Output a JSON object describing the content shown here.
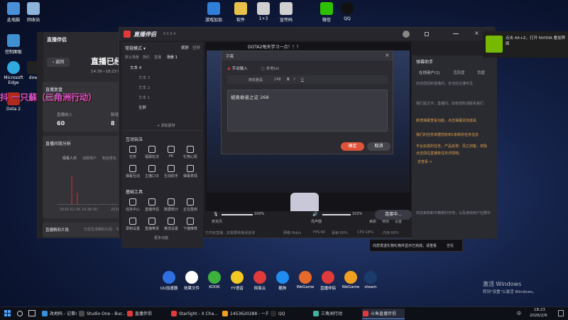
{
  "desktop": {
    "icons": [
      {
        "label": "此电脑",
        "color": "#4a90d9"
      },
      {
        "label": "回收站",
        "color": "#8fb4d9"
      },
      {
        "label": "控制面板",
        "color": "#3f8fd1"
      },
      {
        "label": "Microsoft Edge",
        "color": "#2fa9e0"
      },
      {
        "label": "Dota 2",
        "color": "#b12a1d"
      }
    ],
    "top_icons": [
      {
        "label": "游戏加加",
        "color": "#2f7fd8"
      },
      {
        "label": "软件",
        "color": "#e8c24a"
      },
      {
        "label": "1+3",
        "color": "#d0d0d0"
      },
      {
        "label": "宣传码",
        "color": "#d0d0d0"
      },
      {
        "label": "微信",
        "color": "#2dc100"
      },
      {
        "label": "QQ",
        "color": "#111111"
      }
    ],
    "download_label": "dow"
  },
  "dashboard": {
    "logo": "直播伴侣",
    "back_label": "返回",
    "heading": "直播已经",
    "time_range": "14:36~18:23 时",
    "review_title": "直播复盘",
    "data_summary": "数据汇总",
    "metric1_label": "直播收入",
    "metric1_value": "60",
    "metric2_label": "新增粉丝",
    "metric2_value": "8",
    "analysis_title": "直播间效分析",
    "chart_tabs": [
      "观看人次",
      "消费用户",
      "粉丝变化"
    ],
    "chart_date_start": "2026-02-06 14:36:00",
    "chart_date_end": "2026-02-",
    "highlights_title": "直播精彩片段",
    "highlights_note": "已自生成精彩片段：今天"
  },
  "overlay_banner": "抖 一只蘇（三角洲行动）",
  "main_window": {
    "brand": "直播伴侣",
    "version": "6.5.5.4",
    "stream_title": "DOTA2每天学习一点！！！",
    "mode_label": "常规模式",
    "landscape": "横屏",
    "portrait": "竖屏",
    "tabs": [
      "默认场景",
      "简约",
      "直播",
      "场景 1"
    ],
    "sources": [
      "文本 4",
      "文本 3",
      "文本 2",
      "文本 1",
      "全屏"
    ],
    "add_material": "添加素材",
    "interactive_title": "互动玩法",
    "interactive_tools": [
      "任务",
      "福袋玩法",
      "PK",
      "礼物心愿",
      "弹幕互动",
      "主播口令",
      "互动助手",
      "弹幕表情"
    ],
    "basic_title": "基础工具",
    "basic_tools": [
      "任务中心",
      "直播伴侣",
      "数据统计",
      "正在签到",
      "录制设置",
      "直播带货",
      "推流设置",
      "下播推荐"
    ],
    "more_tools": "更多功能",
    "mic_label": "麦克风",
    "mic_value": "100%",
    "speaker_label": "扬声器",
    "speaker_value": "102%",
    "beauty": "美颜",
    "effects": "特效",
    "settings_label": "设置",
    "start_live": "连接中...",
    "status_tip": "已开启直播，如需要转接请咨询",
    "status_cpu": "CPU:18%",
    "status_mem": "内存:00%",
    "status_fps": "FPS:60",
    "status_net": "网络:0kb/s",
    "status_time": "00:00:00",
    "status_loss": "丢帧:00%"
  },
  "dialog": {
    "title": "字幕",
    "manual_input": "手动输入",
    "local_txt": "本地txt",
    "font_select": "微软雅黑",
    "size_select": "248",
    "input_text": "被勇敢者之证 268",
    "confirm": "确定",
    "cancel": "取消"
  },
  "chat_panel": {
    "title": "弹幕助手",
    "tabs": [
      "在线用户(1)",
      "活跃度",
      "贡献"
    ],
    "messages": [
      "欢迎您回到直播间，仅当前主播可见",
      "我们是文字，直播间，如有侵权请联系我们",
      "新增弹幕查看功能，点击弹幕添加道具",
      "正在你的直播间的场景上架，点击可以查看",
      "我们的任务单据您收到1条新的任务信息",
      "平台派发的任务，产品名称：风之剑客，奖励",
      "点击前往直播有任务详情吧。"
    ],
    "go_link": "去查看 >",
    "footer": "欢迎来到和平精英的天地，以及游戏用户社群中"
  },
  "nvidia": {
    "text": "点击 Alt+Z，打开 NVIDIA 叠加界面"
  },
  "notification": {
    "text": "向您发送礼物礼物并显示已完成，请查看",
    "action": "查看"
  },
  "dock": [
    {
      "label": "UU加速器",
      "color": "#2f6fe0"
    },
    {
      "label": "效果文件",
      "color": "#ffffff"
    },
    {
      "label": "KOOK",
      "color": "#3db33d"
    },
    {
      "label": "YY语音",
      "color": "#f3c823"
    },
    {
      "label": "网易云",
      "color": "#e03a3a"
    },
    {
      "label": "酷狗",
      "color": "#1f8cf0"
    },
    {
      "label": "WeGame",
      "color": "#e86a2a"
    },
    {
      "label": "直播伴侣",
      "color": "#e03a3a"
    },
    {
      "label": "WeGame",
      "color": "#f0a020"
    },
    {
      "label": "steam",
      "color": "#1b3b6a"
    }
  ],
  "watermark": {
    "line1": "激活 Windows",
    "line2": "转到\"设置\"以激活 Windows。"
  },
  "taskbar": {
    "items": [
      {
        "label": "改地码 - 记事本",
        "color": "#3a8fd8"
      },
      {
        "label": "Studio One - Buc...",
        "color": "#4a4a4a"
      },
      {
        "label": "直播伴侣",
        "color": "#e03a3a"
      },
      {
        "label": "Starlight - X Cha...",
        "color": "#e03a3a"
      },
      {
        "label": "1453620288 - 一只蘇",
        "color": "#f0a020"
      },
      {
        "label": "QQ",
        "color": "#2a2a2a"
      },
      {
        "label": "三角洲行动",
        "color": "#3db3a0"
      },
      {
        "label": "斗鱼直播伴侣",
        "color": "#e03a3a"
      }
    ],
    "time": "18:23",
    "date": "2026/2/6",
    "lang": "中"
  }
}
